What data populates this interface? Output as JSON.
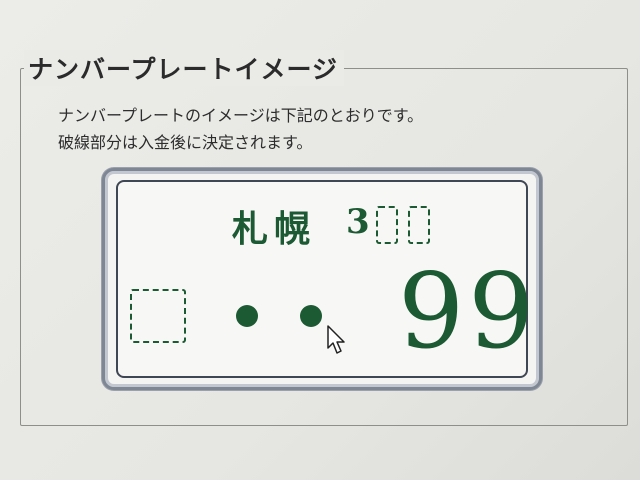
{
  "section_title": "ナンバープレートイメージ",
  "description": {
    "line1": "ナンバープレートのイメージは下記のとおりです。",
    "line2": "破線部分は入金後に決定されます。"
  },
  "plate": {
    "region": "札幌",
    "class_number_prefix": "3",
    "serial_number": "99",
    "colors": {
      "text": "#1c5a33",
      "background": "#f7f7f5",
      "frame": "#3f4654"
    }
  },
  "icons": {
    "cursor": "mouse-pointer-icon"
  }
}
